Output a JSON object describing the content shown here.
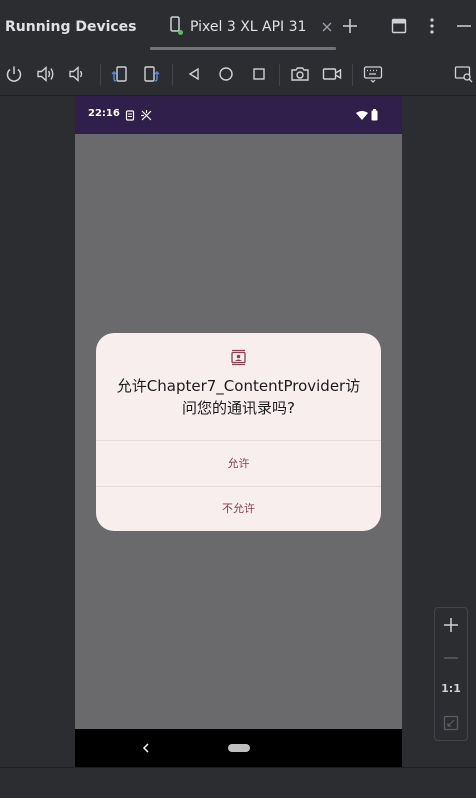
{
  "window": {
    "title": "Running Devices",
    "tab_label": "Pixel 3 XL API 31"
  },
  "toolbar": {
    "icons": [
      "power-icon",
      "volume-up-icon",
      "volume-down-icon",
      "rotate-left-icon",
      "rotate-right-icon",
      "back-icon",
      "home-icon",
      "overview-icon",
      "screenshot-icon",
      "screen-record-icon",
      "keyboard-icon",
      "device-mirror-icon"
    ]
  },
  "device": {
    "status_time": "22:16",
    "dialog": {
      "title": "允许Chapter7_ContentProvider访问您的通讯录吗?",
      "allow_label": "允许",
      "deny_label": "不允许"
    }
  },
  "zoom": {
    "ratio_label": "1:1"
  },
  "colors": {
    "ide_background": "#2b2d30",
    "status_bar": "#2f1f4a",
    "dialog_background": "#f8eeee",
    "dialog_button_text": "#8c3f57"
  }
}
